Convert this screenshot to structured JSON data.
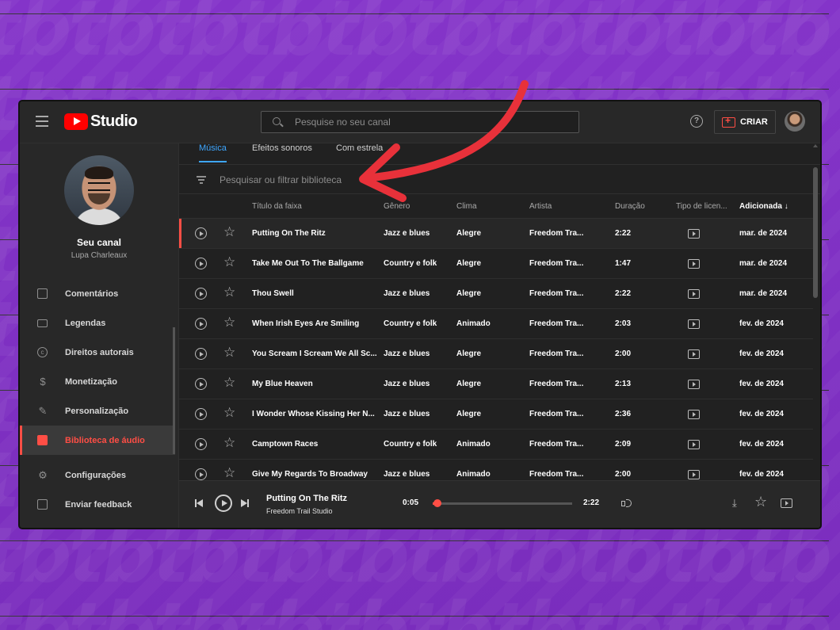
{
  "app": {
    "title": "Studio"
  },
  "search": {
    "placeholder": "Pesquise no seu canal"
  },
  "header": {
    "help_label": "?",
    "create_label": "CRIAR"
  },
  "channel": {
    "name": "Seu canal",
    "user": "Lupa Charleaux"
  },
  "sidebar": {
    "items": [
      {
        "label": "Comentários",
        "icon": "comments-icon"
      },
      {
        "label": "Legendas",
        "icon": "subtitles-icon"
      },
      {
        "label": "Direitos autorais",
        "icon": "copyright-icon"
      },
      {
        "label": "Monetização",
        "icon": "monetization-icon"
      },
      {
        "label": "Personalização",
        "icon": "customization-icon"
      },
      {
        "label": "Biblioteca de áudio",
        "icon": "audio-library-icon",
        "active": true
      },
      {
        "label": "Configurações",
        "icon": "settings-icon"
      },
      {
        "label": "Enviar feedback",
        "icon": "feedback-icon"
      }
    ]
  },
  "tabs": [
    {
      "label": "Música",
      "active": true
    },
    {
      "label": "Efeitos sonoros"
    },
    {
      "label": "Com estrela"
    }
  ],
  "filter": {
    "placeholder": "Pesquisar ou filtrar biblioteca"
  },
  "table": {
    "headers": {
      "title": "Título da faixa",
      "genre": "Gênero",
      "mood": "Clima",
      "artist": "Artista",
      "duration": "Duração",
      "license": "Tipo de licen...",
      "added": "Adicionada",
      "sort_arrow": "↓"
    },
    "rows": [
      {
        "title": "Putting On The Ritz",
        "genre": "Jazz e blues",
        "mood": "Alegre",
        "artist": "Freedom Tra...",
        "duration": "2:22",
        "added": "mar. de 2024"
      },
      {
        "title": "Take Me Out To The Ballgame",
        "genre": "Country e folk",
        "mood": "Alegre",
        "artist": "Freedom Tra...",
        "duration": "1:47",
        "added": "mar. de 2024"
      },
      {
        "title": "Thou Swell",
        "genre": "Jazz e blues",
        "mood": "Alegre",
        "artist": "Freedom Tra...",
        "duration": "2:22",
        "added": "mar. de 2024"
      },
      {
        "title": "When Irish Eyes Are Smiling",
        "genre": "Country e folk",
        "mood": "Animado",
        "artist": "Freedom Tra...",
        "duration": "2:03",
        "added": "fev. de 2024"
      },
      {
        "title": "You Scream I Scream We All Sc...",
        "genre": "Jazz e blues",
        "mood": "Alegre",
        "artist": "Freedom Tra...",
        "duration": "2:00",
        "added": "fev. de 2024"
      },
      {
        "title": "My Blue Heaven",
        "genre": "Jazz e blues",
        "mood": "Alegre",
        "artist": "Freedom Tra...",
        "duration": "2:13",
        "added": "fev. de 2024"
      },
      {
        "title": "I Wonder Whose Kissing Her N...",
        "genre": "Jazz e blues",
        "mood": "Alegre",
        "artist": "Freedom Tra...",
        "duration": "2:36",
        "added": "fev. de 2024"
      },
      {
        "title": "Camptown Races",
        "genre": "Country e folk",
        "mood": "Animado",
        "artist": "Freedom Tra...",
        "duration": "2:09",
        "added": "fev. de 2024"
      },
      {
        "title": "Give My Regards To Broadway",
        "genre": "Jazz e blues",
        "mood": "Animado",
        "artist": "Freedom Tra...",
        "duration": "2:00",
        "added": "fev. de 2024"
      }
    ]
  },
  "player": {
    "title": "Putting On The Ritz",
    "artist": "Freedom Trail Studio",
    "current_time": "0:05",
    "total_time": "2:22",
    "progress": 0.035
  },
  "colors": {
    "background": "#7b2fbe",
    "accent": "#ff4e45",
    "tab_active": "#3ea6ff",
    "brand_red": "#ff0000"
  }
}
